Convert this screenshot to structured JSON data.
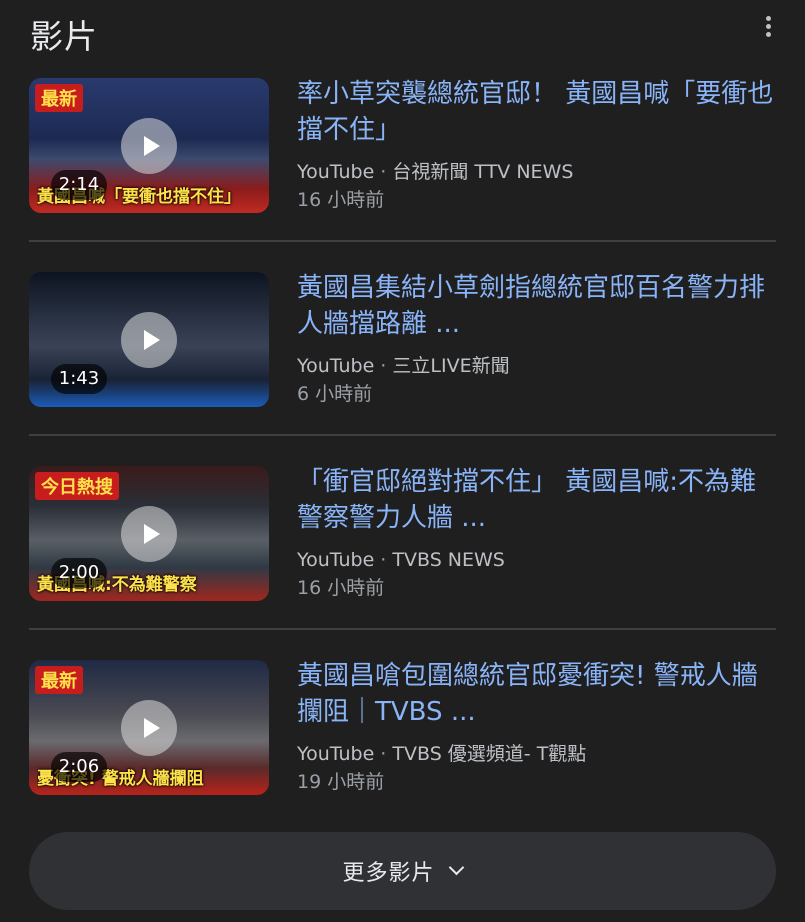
{
  "section": {
    "title": "影片",
    "more_icon": "more-vert-icon"
  },
  "videos": [
    {
      "title": "率小草突襲總統官邸！ 黃國昌喊「要衝也擋不住」",
      "platform": "YouTube",
      "channel": "台視新聞 TTV NEWS",
      "time": "16 小時前",
      "duration": "2:14",
      "thumb_banner": "最新",
      "thumb_caption": "黃國昌喊「要衝也擋不住」"
    },
    {
      "title": "黃國昌集結小草劍指總統官邸百名警力排人牆擋路離 ...",
      "platform": "YouTube",
      "channel": "三立LIVE新聞",
      "time": "6 小時前",
      "duration": "1:43",
      "thumb_banner": "",
      "thumb_caption": ""
    },
    {
      "title": "「衝官邸絕對擋不住」 黃國昌喊:不為難警察警力人牆 ...",
      "platform": "YouTube",
      "channel": "TVBS NEWS",
      "time": "16 小時前",
      "duration": "2:00",
      "thumb_banner": "今日熱搜",
      "thumb_caption": "黃國昌喊:不為難警察"
    },
    {
      "title": "黃國昌嗆包圍總統官邸憂衝突! 警戒人牆攔阻｜TVBS ...",
      "platform": "YouTube",
      "channel": "TVBS 優選頻道- T觀點",
      "time": "19 小時前",
      "duration": "2:06",
      "thumb_banner": "最新",
      "thumb_caption": "憂衝突! 警戒人牆攔阻"
    }
  ],
  "more_button": {
    "label": "更多影片",
    "icon": "chevron-down-icon"
  },
  "colors": {
    "background": "#1f1f1f",
    "link": "#8ab4f8",
    "meta": "#bdc1c6",
    "divider": "#3c4043",
    "button": "#303134"
  }
}
